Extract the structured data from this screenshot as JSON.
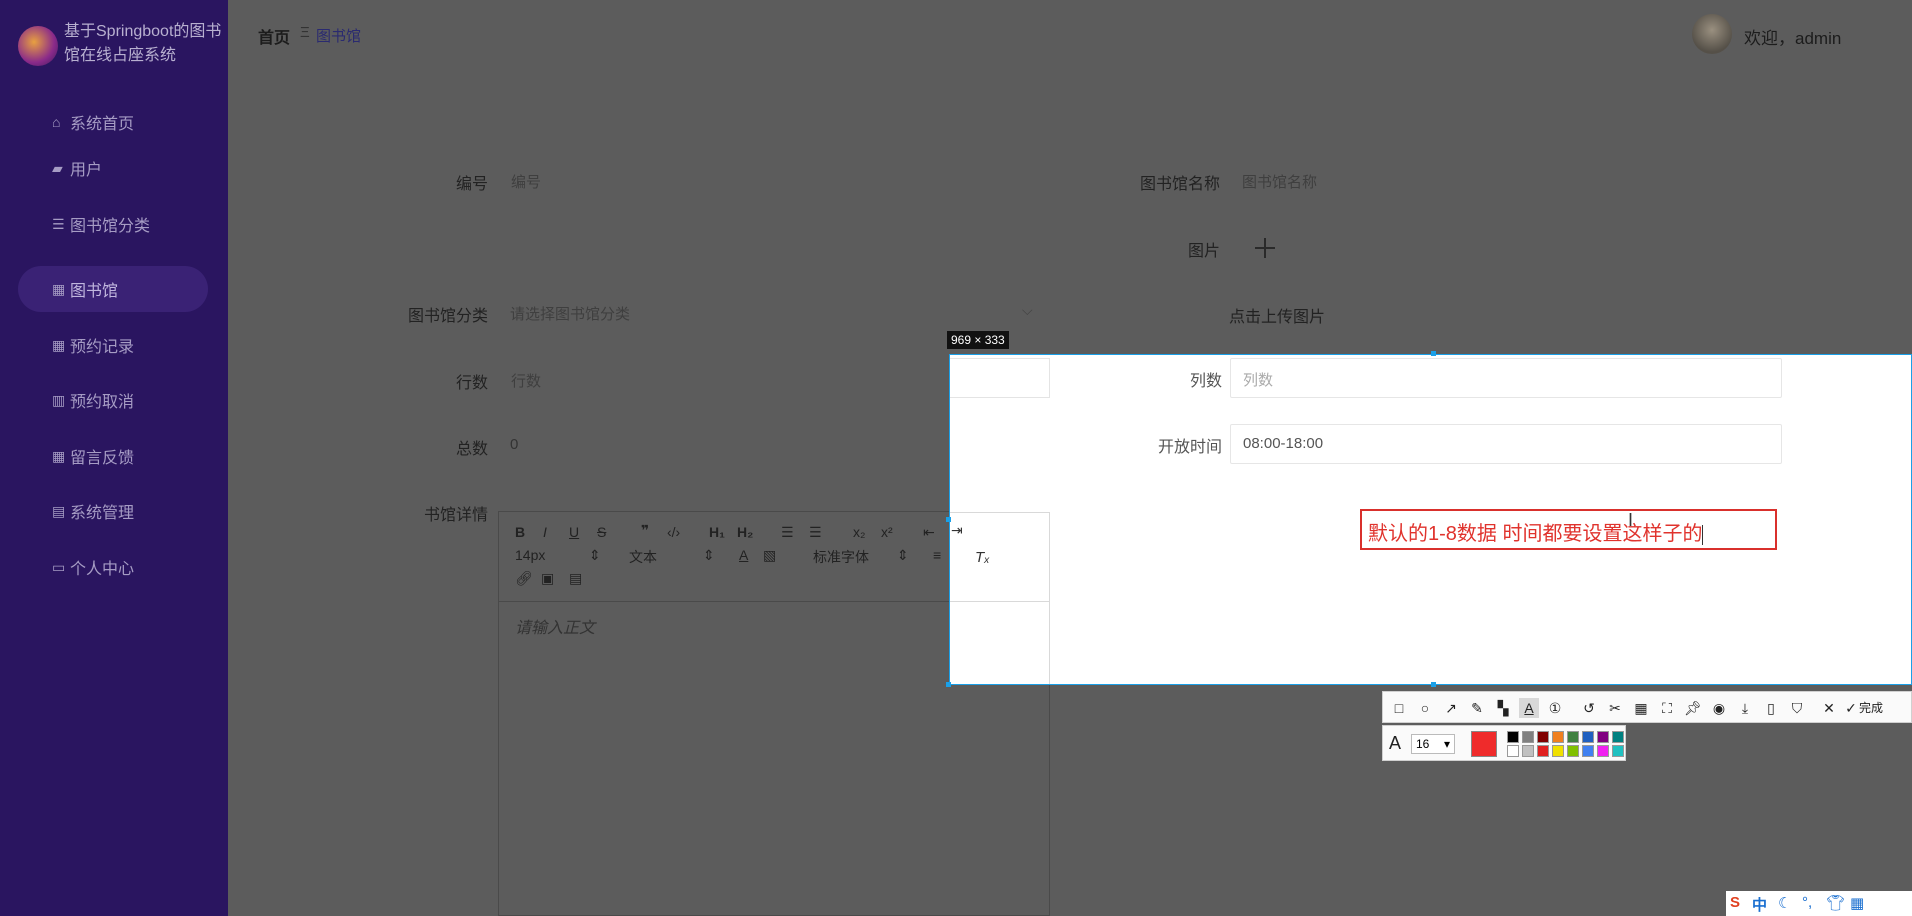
{
  "sidebar": {
    "app_title": "基于Springboot的图书馆在线占座系统",
    "items": [
      {
        "label": "系统首页",
        "icon": "home-icon"
      },
      {
        "label": "用户",
        "icon": "user-icon"
      },
      {
        "label": "图书馆分类",
        "icon": "sliders-icon"
      },
      {
        "label": "图书馆",
        "icon": "grid-icon",
        "active": true
      },
      {
        "label": "预约记录",
        "icon": "grid-icon"
      },
      {
        "label": "预约取消",
        "icon": "book-icon"
      },
      {
        "label": "留言反馈",
        "icon": "grid-icon"
      },
      {
        "label": "系统管理",
        "icon": "clipboard-icon"
      },
      {
        "label": "个人中心",
        "icon": "id-card-icon"
      }
    ]
  },
  "header": {
    "breadcrumb_home": "首页",
    "breadcrumb_sep": "Ξ",
    "breadcrumb_current": "图书馆",
    "welcome": "欢迎，admin"
  },
  "form": {
    "bianhao_label": "编号",
    "bianhao_placeholder": "编号",
    "name_label": "图书馆名称",
    "name_placeholder": "图书馆名称",
    "image_label": "图片",
    "upload_text": "点击上传图片",
    "category_label": "图书馆分类",
    "category_placeholder": "请选择图书馆分类",
    "rows_label": "行数",
    "rows_placeholder": "行数",
    "cols_label": "列数",
    "cols_placeholder": "列数",
    "total_label": "总数",
    "total_value": "0",
    "open_time_label": "开放时间",
    "open_time_value": "08:00-18:00",
    "detail_label": "书馆详情",
    "editor_placeholder": "请输入正文",
    "font_size": "14px",
    "text_style": "文本",
    "font_family": "标准字体"
  },
  "screenshot_tool": {
    "size_label": "969 × 333",
    "annotation_text": "默认的1-8数据 时间都要设置这样子的",
    "done_label": "完成",
    "font_size_value": "16",
    "current_color": "#ef2b2b",
    "palette": [
      "#000000",
      "#808080",
      "#800000",
      "#f08020",
      "#408040",
      "#2060c0",
      "#800080",
      "#008080",
      "#ffffff",
      "#c0c0c0",
      "#e02020",
      "#f0e000",
      "#80c000",
      "#4080f0",
      "#f020f0",
      "#20c0c0"
    ]
  },
  "tray": {
    "ime": "中"
  }
}
